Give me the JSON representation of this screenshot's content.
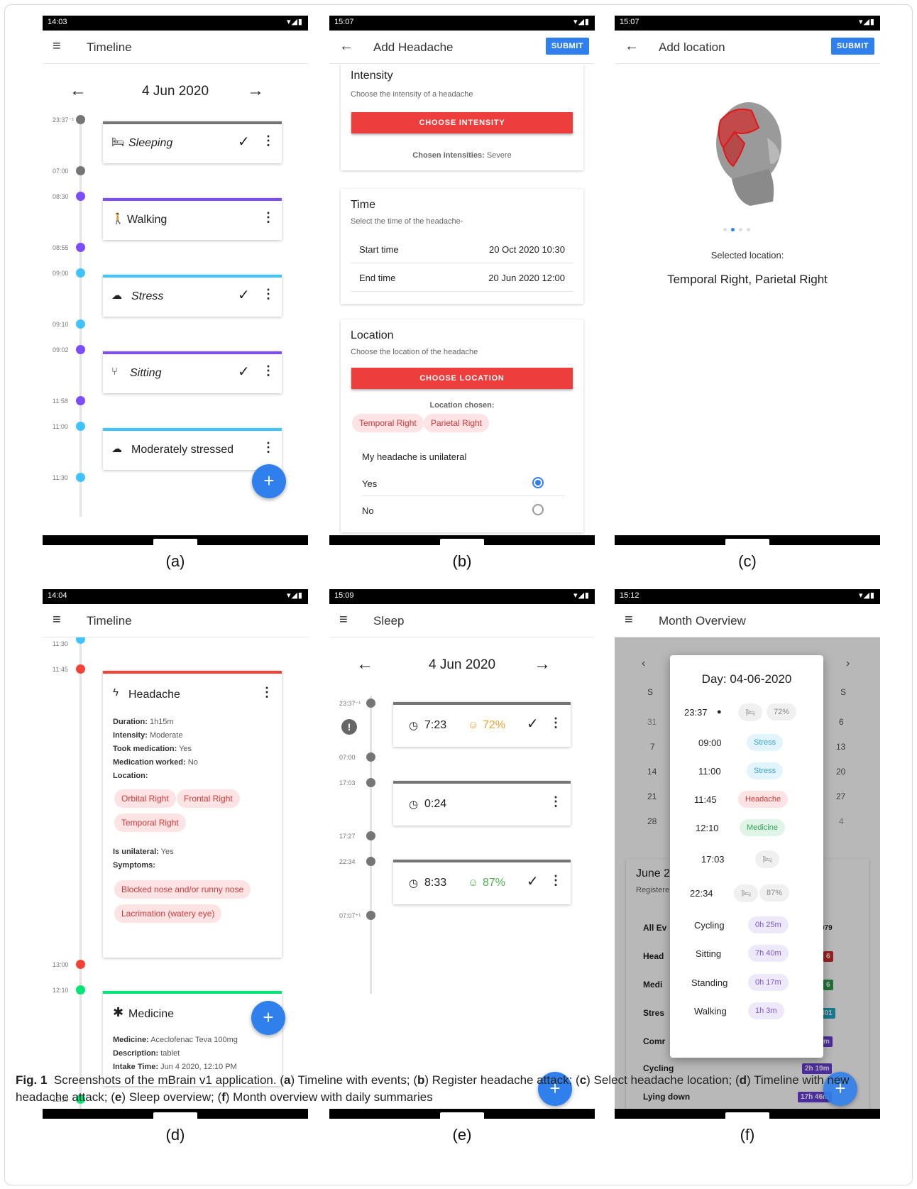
{
  "panels": {
    "a": {
      "letter": "(a)",
      "status_time": "14:03",
      "title": "Timeline",
      "date": "4 Jun 2020",
      "times": [
        "23:37⁻¹",
        "07:00",
        "08:30",
        "08:55",
        "09:00",
        "09:10",
        "09:02",
        "11:58",
        "11:00",
        "11:30"
      ],
      "events": [
        "Sleeping",
        "Walking",
        "Stress",
        "Sitting",
        "Moderately stressed"
      ]
    },
    "b": {
      "letter": "(b)",
      "status_time": "15:07",
      "title": "Add Headache",
      "submit": "SUBMIT",
      "intensity_title": "Intensity",
      "intensity_sub": "Choose the intensity of a headache",
      "intensity_btn": "CHOOSE INTENSITY",
      "intensity_chosen_label": "Chosen intensities:",
      "intensity_chosen_value": "Severe",
      "time_title": "Time",
      "time_sub": "Select the time of the headache-",
      "start_label": "Start time",
      "start_value": "20 Oct 2020 10:30",
      "end_label": "End time",
      "end_value": "20 Jun 2020 12:00",
      "location_title": "Location",
      "location_sub": "Choose the location of the headache",
      "location_btn": "CHOOSE LOCATION",
      "location_chosen": "Location chosen:",
      "chips": [
        "Temporal Right",
        "Parietal Right"
      ],
      "unilateral_q": "My headache is unilateral",
      "yes": "Yes",
      "no": "No"
    },
    "c": {
      "letter": "(c)",
      "status_time": "15:07",
      "title": "Add location",
      "submit": "SUBMIT",
      "selected_label": "Selected location:",
      "selected_value": "Temporal Right, Parietal Right"
    },
    "d": {
      "letter": "(d)",
      "status_time": "14:04",
      "title": "Timeline",
      "times": [
        "11:30",
        "11:45",
        "13:00",
        "12:10",
        "12:10"
      ],
      "headache_title": "Headache",
      "duration_label": "Duration:",
      "duration_value": "1h15m",
      "intensity_label": "Intensity:",
      "intensity_value": "Moderate",
      "took_label": "Took medication:",
      "took_value": "Yes",
      "worked_label": "Medication worked:",
      "worked_value": "No",
      "location_label": "Location:",
      "loc_chips": [
        "Orbital Right",
        "Frontal Right",
        "Temporal Right"
      ],
      "unilateral_label": "Is unilateral:",
      "unilateral_value": "Yes",
      "symptoms_label": "Symptoms:",
      "symptom_chips": [
        "Blocked nose and/or runny nose",
        "Lacrimation (watery eye)"
      ],
      "medicine_title": "Medicine",
      "med_label": "Medicine:",
      "med_value": "Aceclofenac Teva 100mg",
      "desc_label": "Description:",
      "desc_value": "tablet",
      "intake_label": "Intake Time:",
      "intake_value": "Jun 4 2020, 12:10 PM"
    },
    "e": {
      "letter": "(e)",
      "status_time": "15:09",
      "title": "Sleep",
      "date": "4 Jun 2020",
      "times": [
        "23:37⁻¹",
        "07:00",
        "17:03",
        "17:27",
        "22:34",
        "07:07⁺¹"
      ],
      "sleeps": [
        {
          "duration": "7:23",
          "quality": "72%"
        },
        {
          "duration": "0:24",
          "quality": ""
        },
        {
          "duration": "8:33",
          "quality": "87%"
        }
      ]
    },
    "f": {
      "letter": "(f)",
      "status_time": "15:12",
      "title": "Month Overview",
      "dow_left": "S",
      "dow_right": "S",
      "cal_left": [
        "31",
        "7",
        "14",
        "21",
        "28"
      ],
      "cal_right": [
        "6",
        "13",
        "20",
        "27",
        "4"
      ],
      "month_title": "June 2",
      "registered": "Registere",
      "overview_rows": [
        {
          "label": "All Ev",
          "value": "979"
        },
        {
          "label": "Head",
          "value": "6"
        },
        {
          "label": "Medi",
          "value": "6"
        },
        {
          "label": "Stres",
          "value": "401"
        },
        {
          "label": "Comr",
          "value": "h 35m"
        },
        {
          "label": "Cycling",
          "value": "2h 19m"
        },
        {
          "label": "Lying down",
          "value": "17h 46m"
        }
      ],
      "dialog_title": "Day: 04-06-2020",
      "dialog_rows": [
        {
          "time": "23:37",
          "pill": "",
          "extra": "72%"
        },
        {
          "time": "09:00",
          "pill": "Stress"
        },
        {
          "time": "11:00",
          "pill": "Stress"
        },
        {
          "time": "11:45",
          "pill": "Headache"
        },
        {
          "time": "12:10",
          "pill": "Medicine"
        },
        {
          "time": "17:03",
          "pill": ""
        },
        {
          "time": "22:34",
          "pill": "",
          "extra": "87%"
        },
        {
          "time": "Cycling",
          "pill": "0h 25m"
        },
        {
          "time": "Sitting",
          "pill": "7h 40m"
        },
        {
          "time": "Standing",
          "pill": "0h 17m"
        },
        {
          "time": "Walking",
          "pill": "1h 3m"
        }
      ]
    }
  },
  "caption": {
    "label": "Fig. 1",
    "text_1": "Screenshots of the mBrain v1 application. (",
    "text_a": "a",
    "text_2": ") Timeline with events; (",
    "text_b": "b",
    "text_3": ") Register headache attack; (",
    "text_c": "c",
    "text_4": ") Select headache location; (",
    "text_d": "d",
    "text_5": ") Timeline with new headache attack; (",
    "text_e": "e",
    "text_6": ") Sleep overview; (",
    "text_f": "f",
    "text_7": ") Month overview with daily summaries"
  },
  "colors": {
    "sleep": "#757575",
    "walk": "#7c4dff",
    "stress": "#40c4ff",
    "headache": "#f44336",
    "medicine": "#00e676",
    "accent": "#2f80ed"
  },
  "icons": [
    "menu-icon",
    "arrow-left-icon",
    "arrow-right-icon",
    "bed-icon",
    "walk-icon",
    "cloud-bolt-icon",
    "chair-icon",
    "check-icon",
    "more-vert-icon",
    "plus-icon",
    "clock-icon",
    "smile-icon",
    "alert-icon",
    "bolt-icon",
    "asterisk-icon",
    "wifi-icon",
    "signal-icon",
    "battery-icon",
    "chevron-left-icon",
    "chevron-right-icon"
  ]
}
